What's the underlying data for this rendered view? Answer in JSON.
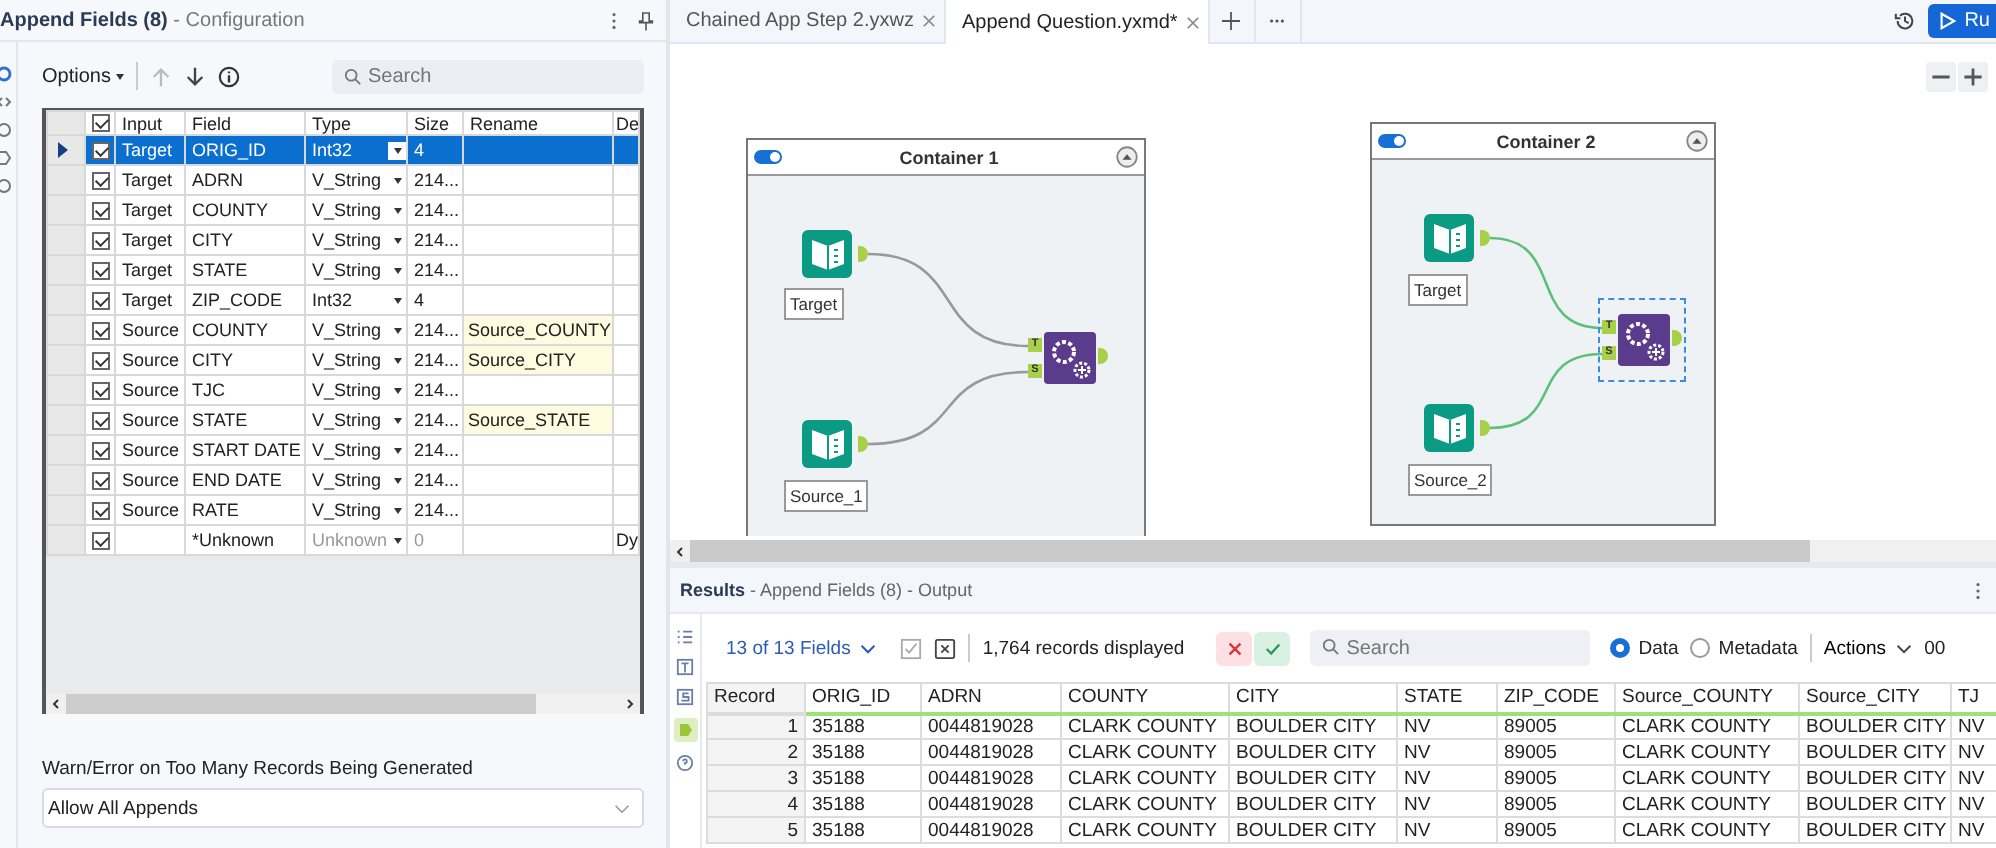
{
  "config_panel": {
    "title": "**Append Fields (8)** - Configuration",
    "options_button": "Options",
    "search": {
      "placeholder": "Search"
    },
    "grid": {
      "all_checked": true,
      "columns": [
        "Input",
        "Field",
        "Type",
        "Size",
        "Rename",
        "De"
      ],
      "rows": [
        {
          "kind": "field",
          "input": "Target",
          "field": "ORIG_ID",
          "type": "Int32",
          "size": "4",
          "checked": true,
          "selected": true
        },
        {
          "kind": "field",
          "input": "Target",
          "field": "ADRN",
          "type": "V_String",
          "size": "214...",
          "checked": true,
          "selected": false
        },
        {
          "kind": "field",
          "input": "Target",
          "field": "COUNTY",
          "type": "V_String",
          "size": "214...",
          "checked": true,
          "selected": false
        },
        {
          "kind": "field",
          "input": "Target",
          "field": "CITY",
          "type": "V_String",
          "size": "214...",
          "checked": true,
          "selected": false
        },
        {
          "kind": "field",
          "input": "Target",
          "field": "STATE",
          "type": "V_String",
          "size": "214...",
          "checked": true,
          "selected": false
        },
        {
          "kind": "field",
          "input": "Target",
          "field": "ZIP_CODE",
          "type": "Int32",
          "size": "4",
          "checked": true,
          "selected": false
        },
        {
          "kind": "field",
          "input": "Source",
          "field": "COUNTY",
          "type": "V_String",
          "size": "214...",
          "rename": "Source_COUNTY",
          "checked": true,
          "selected": false
        },
        {
          "kind": "field",
          "input": "Source",
          "field": "CITY",
          "type": "V_String",
          "size": "214...",
          "rename": "Source_CITY",
          "checked": true,
          "selected": false
        },
        {
          "kind": "field",
          "input": "Source",
          "field": "TJC",
          "type": "V_String",
          "size": "214...",
          "checked": true,
          "selected": false
        },
        {
          "kind": "field",
          "input": "Source",
          "field": "STATE",
          "type": "V_String",
          "size": "214...",
          "rename": "Source_STATE",
          "checked": true,
          "selected": false
        },
        {
          "kind": "field",
          "input": "Source",
          "field": "START DATE",
          "type": "V_String",
          "size": "214...",
          "checked": true,
          "selected": false
        },
        {
          "kind": "field",
          "input": "Source",
          "field": "END DATE",
          "type": "V_String",
          "size": "214...",
          "checked": true,
          "selected": false
        },
        {
          "kind": "field",
          "input": "Source",
          "field": "RATE",
          "type": "V_String",
          "size": "214...",
          "checked": true,
          "selected": false
        },
        {
          "kind": "unknown",
          "field": "*Unknown",
          "type": "Unknown",
          "size": "0",
          "description": "Dy",
          "checked": true,
          "selected": false
        }
      ]
    },
    "option": {
      "label": "Warn/Error on Too Many Records Being Generated",
      "value": "Allow All Appends"
    }
  },
  "tabs": [
    {
      "label": "Chained App Step 2.yxwz",
      "selected": false
    },
    {
      "label": "Append Question.yxmd*",
      "selected": true
    }
  ],
  "run_button": "Ru",
  "canvas": {
    "containers": [
      {
        "title": "Container 1",
        "enabled": true,
        "inputs": [
          {
            "label": "Target"
          },
          {
            "label": "Source_1"
          }
        ],
        "ports": [
          "T",
          "S"
        ],
        "join_selected": false,
        "connections_run": false
      },
      {
        "title": "Container 2",
        "enabled": true,
        "inputs": [
          {
            "label": "Target"
          },
          {
            "label": "Source_2"
          }
        ],
        "ports": [
          "T",
          "S"
        ],
        "join_selected": true,
        "connections_run": true
      }
    ]
  },
  "results": {
    "title": "**Results** - Append Fields (8) - Output",
    "fields_button": "13 of 13 Fields",
    "record_count": "1,764 records displayed",
    "search": {
      "placeholder": "Search"
    },
    "views": [
      {
        "label": "Data",
        "selected": true
      },
      {
        "label": "Metadata",
        "selected": false
      }
    ],
    "actions": "Actions",
    "trailing": "00",
    "columns": [
      "Record",
      "ORIG_ID",
      "ADRN",
      "COUNTY",
      "CITY",
      "STATE",
      "ZIP_CODE",
      "Source_COUNTY",
      "Source_CITY",
      "TJ"
    ],
    "rows": [
      [
        "1",
        "35188",
        "0044819028",
        "CLARK COUNTY",
        "BOULDER CITY",
        "NV",
        "89005",
        "CLARK COUNTY",
        "BOULDER CITY",
        "NV"
      ],
      [
        "2",
        "35188",
        "0044819028",
        "CLARK COUNTY",
        "BOULDER CITY",
        "NV",
        "89005",
        "CLARK COUNTY",
        "BOULDER CITY",
        "NV"
      ],
      [
        "3",
        "35188",
        "0044819028",
        "CLARK COUNTY",
        "BOULDER CITY",
        "NV",
        "89005",
        "CLARK COUNTY",
        "BOULDER CITY",
        "NV"
      ],
      [
        "4",
        "35188",
        "0044819028",
        "CLARK COUNTY",
        "BOULDER CITY",
        "NV",
        "89005",
        "CLARK COUNTY",
        "BOULDER CITY",
        "NV"
      ],
      [
        "5",
        "35188",
        "0044819028",
        "CLARK COUNTY",
        "BOULDER CITY",
        "NV",
        "89005",
        "CLARK COUNTY",
        "BOULDER CITY",
        "NV"
      ]
    ]
  }
}
